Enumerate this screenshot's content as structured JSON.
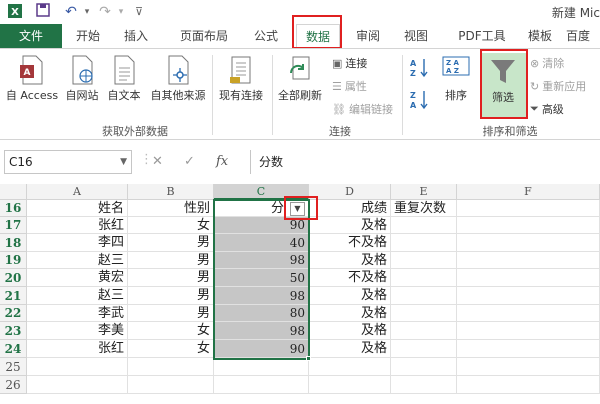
{
  "app": {
    "title": "新建 Mic"
  },
  "tabs": [
    {
      "label": "文件"
    },
    {
      "label": "开始"
    },
    {
      "label": "插入"
    },
    {
      "label": "页面布局"
    },
    {
      "label": "公式"
    },
    {
      "label": "数据"
    },
    {
      "label": "审阅"
    },
    {
      "label": "视图"
    },
    {
      "label": "PDF工具"
    },
    {
      "label": "模板"
    },
    {
      "label": "百度"
    }
  ],
  "ribbon": {
    "external": {
      "access": "自 Access",
      "web": "自网站",
      "text": "自文本",
      "other": "自其他来源",
      "existing": "现有连接",
      "group": "获取外部数据"
    },
    "connections": {
      "refresh": "全部刷新",
      "connect": "连接",
      "properties": "属性",
      "edit_links": "编辑链接",
      "group": "连接"
    },
    "sortfilter": {
      "sort": "排序",
      "filter": "筛选",
      "clear": "清除",
      "reapply": "重新应用",
      "advanced": "高级",
      "group": "排序和筛选"
    }
  },
  "formula_bar": {
    "name_box": "C16",
    "cancel": "✕",
    "enter": "✓",
    "fx": "fx",
    "value": "分数"
  },
  "grid": {
    "columns": [
      "A",
      "B",
      "C",
      "D",
      "E",
      "F"
    ],
    "rows": [
      {
        "n": "16",
        "a": "姓名",
        "b": "性别",
        "c": "分",
        "d": "成绩",
        "e": "重复次数"
      },
      {
        "n": "17",
        "a": "张红",
        "b": "女",
        "c": "90",
        "d": "及格",
        "e": ""
      },
      {
        "n": "18",
        "a": "李四",
        "b": "男",
        "c": "40",
        "d": "不及格",
        "e": ""
      },
      {
        "n": "19",
        "a": "赵三",
        "b": "男",
        "c": "98",
        "d": "及格",
        "e": ""
      },
      {
        "n": "20",
        "a": "黄宏",
        "b": "男",
        "c": "50",
        "d": "不及格",
        "e": ""
      },
      {
        "n": "21",
        "a": "赵三",
        "b": "男",
        "c": "98",
        "d": "及格",
        "e": ""
      },
      {
        "n": "22",
        "a": "李武",
        "b": "男",
        "c": "80",
        "d": "及格",
        "e": ""
      },
      {
        "n": "23",
        "a": "李美",
        "b": "女",
        "c": "98",
        "d": "及格",
        "e": ""
      },
      {
        "n": "24",
        "a": "张红",
        "b": "女",
        "c": "90",
        "d": "及格",
        "e": ""
      },
      {
        "n": "25",
        "a": "",
        "b": "",
        "c": "",
        "d": "",
        "e": ""
      },
      {
        "n": "26",
        "a": "",
        "b": "",
        "c": "",
        "d": "",
        "e": ""
      }
    ]
  },
  "colors": {
    "accent": "#217346",
    "highlight": "#e02020",
    "selection": "#c6c6c6"
  }
}
